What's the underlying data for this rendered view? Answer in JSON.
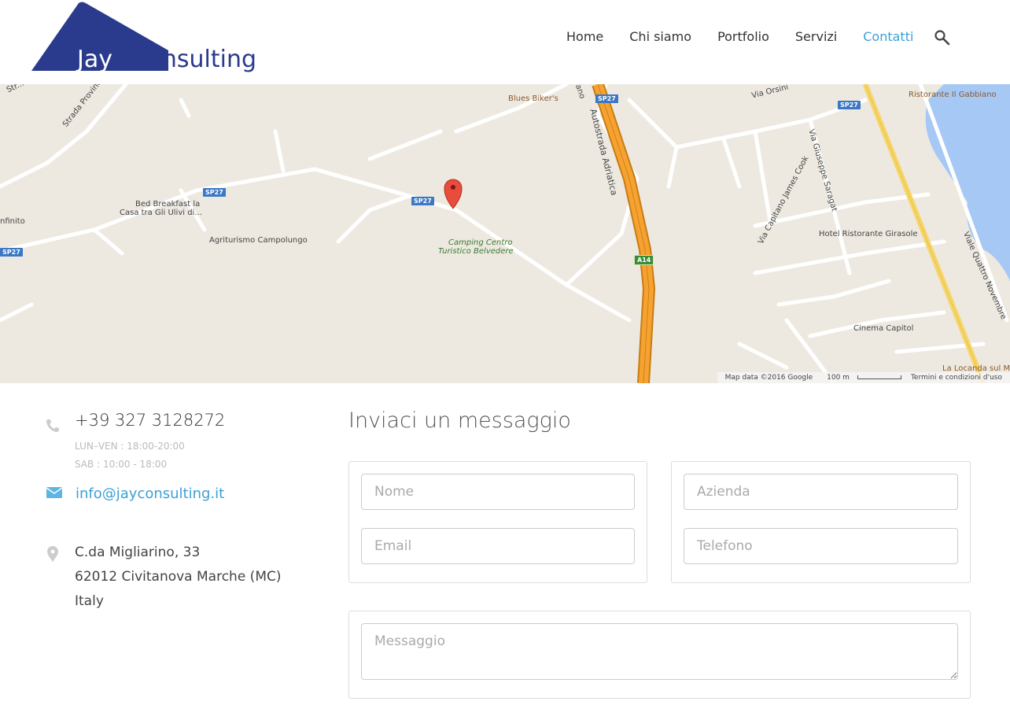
{
  "brand": {
    "logo_word1": "Jay",
    "logo_word2": "consulting",
    "primary_color": "#2a3a8c",
    "accent_color": "#3ba0d6"
  },
  "nav": {
    "items": [
      {
        "label": "Home",
        "active": false
      },
      {
        "label": "Chi siamo",
        "active": false
      },
      {
        "label": "Portfolio",
        "active": false
      },
      {
        "label": "Servizi",
        "active": false
      },
      {
        "label": "Contatti",
        "active": true
      }
    ],
    "search_icon": "search-icon"
  },
  "map": {
    "labels": {
      "strada": "Strada Provinciale Mo",
      "blues": "Blues Biker's",
      "autostrada": "Autostrada Adriatica",
      "via_orsini": "Via Orsini",
      "gabbiano": "Ristorante Il Gabbiano",
      "saragat": "Via Giuseppe Saragat",
      "james_cook": "Via Capitano James Cook",
      "bb1": "Bed Breakfast la",
      "bb2": "Casa tra Gli Ulivi di...",
      "infinito": "nfinito",
      "campolungo": "Agriturismo Campolungo",
      "camping1": "Camping Centro",
      "camping2": "Turistico Belvedere",
      "girasole": "Hotel Ristorante Girasole",
      "quattro": "Viale Quattro Novembre",
      "capitol": "Cinema Capitol",
      "locanda": "La Locanda sul M",
      "str": "Str...",
      "ano": "ano"
    },
    "badges": {
      "sp27": "SP27",
      "a14": "A14"
    },
    "footer": {
      "data": "Map data ©2016 Google",
      "scale": "100 m",
      "terms": "Termini e condizioni d'uso"
    }
  },
  "contact": {
    "phone": "+39 327 3128272",
    "hours_weekday": "LUN–VEN : 18:00-20:00",
    "hours_saturday": "SAB  : 10:00 - 18:00",
    "email": "info@jayconsulting.it",
    "address_line1": "C.da Migliarino, 33",
    "address_line2": "62012 Civitanova Marche (MC)",
    "address_line3": "Italy"
  },
  "form": {
    "title": "Inviaci un messaggio",
    "name_placeholder": "Nome",
    "email_placeholder": "Email",
    "company_placeholder": "Azienda",
    "phone_placeholder": "Telefono",
    "message_placeholder": "Messaggio"
  }
}
